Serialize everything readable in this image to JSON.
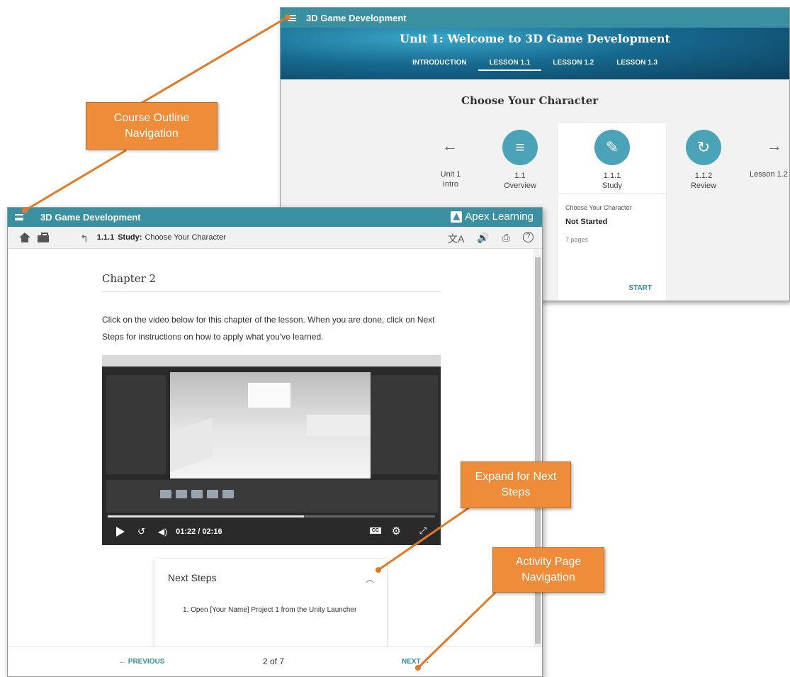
{
  "outline": {
    "app_title": "3D Game Development",
    "unit_title": "Unit 1: Welcome to 3D Game Development",
    "tabs": [
      "INTRODUCTION",
      "LESSON 1.1",
      "LESSON 1.2",
      "LESSON 1.3"
    ],
    "active_tab": "LESSON 1.1",
    "section_title": "Choose Your Character",
    "prev_step": {
      "line1": "Unit 1",
      "line2": "Intro"
    },
    "steps": [
      {
        "number": "1.1",
        "label": "Overview",
        "icon": "list-icon"
      },
      {
        "number": "1.1.1",
        "label": "Study",
        "icon": "pencil-icon"
      },
      {
        "number": "1.1.2",
        "label": "Review",
        "icon": "refresh-icon"
      }
    ],
    "next_step": {
      "label": "Lesson 1.2"
    },
    "card": {
      "subtitle": "Choose Your Character",
      "status": "Not Started",
      "pages": "7 pages",
      "action": "START"
    }
  },
  "activity": {
    "app_title": "3D Game Development",
    "brand": "Apex Learning",
    "breadcrumb": {
      "id": "1.1.1",
      "label": "Study:",
      "title": "Choose Your Character"
    },
    "chapter_title": "Chapter 2",
    "intro_text": "Click on the video below for this chapter of the lesson. When you are done, click on Next Steps for instructions on how to apply what you've learned.",
    "video": {
      "time": "01:22 / 02:16",
      "progress_fraction": 0.6,
      "cc_label": "CC"
    },
    "next_steps": {
      "title": "Next Steps",
      "items": [
        "1. Open [Your Name] Project 1 from the Unity Launcher"
      ]
    },
    "footer": {
      "previous": "PREVIOUS",
      "page_count": "2 of 7",
      "next": "NEXT"
    }
  },
  "callouts": {
    "course_outline": "Course Outline Navigation",
    "expand_next": "Expand for Next Steps",
    "activity_nav": "Activity Page Navigation"
  },
  "colors": {
    "primary": "#3a8fa0",
    "callout": "#ef8c3a",
    "link": "#2f8fa5"
  }
}
